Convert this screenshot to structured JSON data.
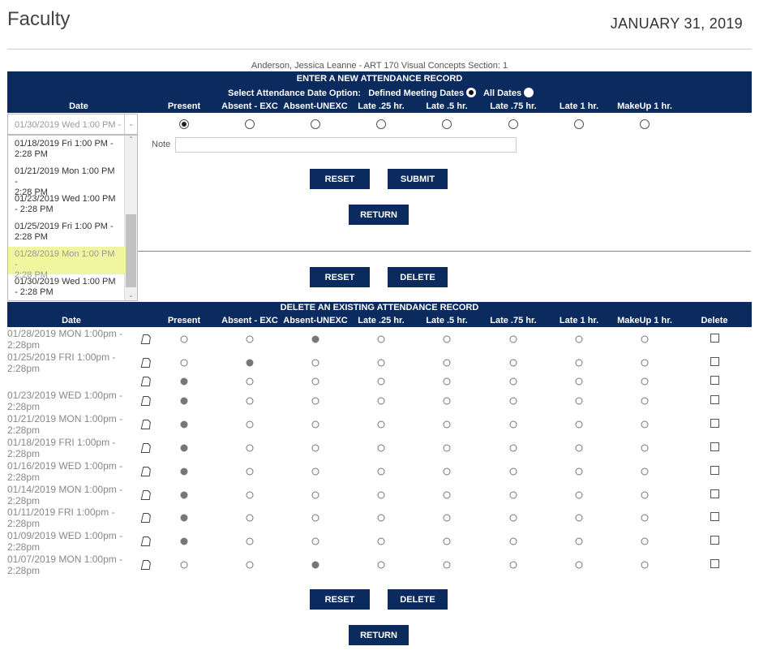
{
  "header": {
    "title": "Faculty",
    "date": "JANUARY 31, 2019",
    "student_line": "Anderson, Jessica Leanne - ART 170 Visual Concepts Section: 1"
  },
  "new_record": {
    "heading": "ENTER A NEW ATTENDANCE RECORD",
    "option_label": "Select Attendance Date Option:",
    "option_defined": "Defined Meeting Dates",
    "option_all": "All Dates",
    "selected_option": "Defined Meeting Dates",
    "date_col": "Date",
    "columns": [
      "Present",
      "Absent - EXC",
      "Absent-UNEXC",
      "Late .25 hr.",
      "Late .5 hr.",
      "Late .75 hr.",
      "Late 1 hr.",
      "MakeUp 1 hr."
    ],
    "selected_status": "Present",
    "date_select_value": "01/30/2019 Wed 1:00 PM -",
    "date_options": [
      {
        "label": "01/18/2019 Fri 1:00 PM - 2:28 PM",
        "line1": "01/18/2019 Fri 1:00 PM -",
        "line2": "2:28 PM"
      },
      {
        "label": "01/21/2019 Mon 1:00 PM - 2:28 PM",
        "line1": "01/21/2019 Mon 1:00 PM -",
        "line2": "2:28 PM"
      },
      {
        "label": "01/23/2019 Wed 1:00 PM - 2:28 PM",
        "line1": "01/23/2019 Wed 1:00 PM",
        "line2": "- 2:28 PM"
      },
      {
        "label": "01/25/2019 Fri 1:00 PM - 2:28 PM",
        "line1": "01/25/2019 Fri 1:00 PM -",
        "line2": "2:28 PM"
      },
      {
        "label": "01/28/2019 Mon 1:00 PM - 2:28 PM",
        "line1": "01/28/2019 Mon 1:00 PM -",
        "line2": "2:28 PM",
        "highlighted": true
      },
      {
        "label": "01/30/2019 Wed 1:00 PM - 2:28 PM",
        "line1": "01/30/2019 Wed 1:00 PM",
        "line2": "- 2:28 PM"
      }
    ],
    "note_label": "Note",
    "note_value": "",
    "reset_label": "RESET",
    "submit_label": "SUBMIT",
    "return_label": "RETURN"
  },
  "mid_buttons": {
    "reset_label": "RESET",
    "delete_label": "DELETE"
  },
  "existing": {
    "heading": "DELETE AN EXISTING ATTENDANCE RECORD",
    "date_col": "Date",
    "columns": [
      "Present",
      "Absent - EXC",
      "Absent-UNEXC",
      "Late .25 hr.",
      "Late .5 hr.",
      "Late .75 hr.",
      "Late 1 hr.",
      "MakeUp 1 hr."
    ],
    "delete_col": "Delete",
    "rows": [
      {
        "line1": "01/28/2019 MON 1:00pm -",
        "line2": "2:28pm",
        "status": "Absent-UNEXC"
      },
      {
        "line1": "01/25/2019 FRI 1:00pm -",
        "line2": "2:28pm",
        "status": "Absent - EXC"
      },
      {
        "line1": "",
        "line2": "",
        "status": "Present"
      },
      {
        "line1": "01/23/2019 WED 1:00pm -",
        "line2": "2:28pm",
        "status": "Present"
      },
      {
        "line1": "01/21/2019 MON 1:00pm -",
        "line2": "2:28pm",
        "status": "Present"
      },
      {
        "line1": "01/18/2019 FRI 1:00pm -",
        "line2": "2:28pm",
        "status": "Present"
      },
      {
        "line1": "01/16/2019 WED 1:00pm -",
        "line2": "2:28pm",
        "status": "Present"
      },
      {
        "line1": "01/14/2019 MON 1:00pm -",
        "line2": "2:28pm",
        "status": "Present"
      },
      {
        "line1": "01/11/2019 FRI 1:00pm -",
        "line2": "2:28pm",
        "status": "Present"
      },
      {
        "line1": "01/09/2019 WED 1:00pm -",
        "line2": "2:28pm",
        "status": "Present"
      },
      {
        "line1": "01/07/2019 MON 1:00pm -",
        "line2": "2:28pm",
        "status": "Absent-UNEXC"
      }
    ],
    "reset_label": "RESET",
    "delete_label": "DELETE",
    "return_label": "RETURN"
  },
  "colors": {
    "navy": "#0b2a5e",
    "highlight": "#f0f5a0"
  }
}
